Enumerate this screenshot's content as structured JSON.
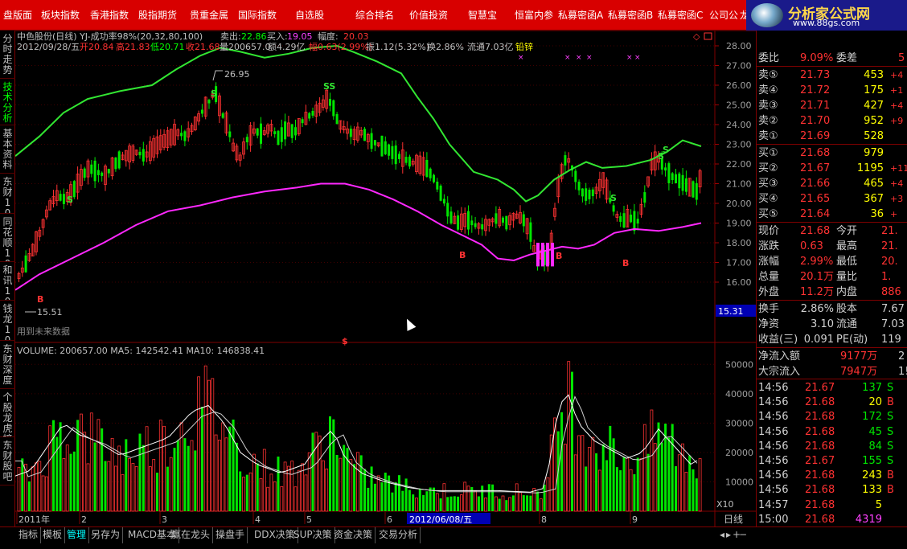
{
  "menu": [
    "盘版面",
    "板块指数",
    "香港指数",
    "股指期货",
    "贵重金属",
    "国际指数",
    "自选股",
    "综合排名",
    "价值投资",
    "智慧宝",
    "恒富内参",
    "私募密函A",
    "私募密函B",
    "私募密函C",
    "公司公告",
    "龙"
  ],
  "brand": {
    "name": "分析家公式网",
    "url": "www.88gs.com"
  },
  "left_tabs": [
    {
      "label": "分时走势",
      "active": false
    },
    {
      "label": "技术分析",
      "active": true
    },
    {
      "label": "基本资料",
      "active": false
    },
    {
      "label": "东财10",
      "active": false
    },
    {
      "label": "同花顺10",
      "active": false
    },
    {
      "label": "和讯10",
      "active": false
    },
    {
      "label": "钱龙10",
      "active": false
    },
    {
      "label": "东财深度",
      "active": false
    },
    {
      "label": "个股龙虎榜",
      "active": false
    },
    {
      "label": "东财股吧",
      "active": false
    }
  ],
  "header": {
    "title": "中色股份(日线) YJ-成功率98%(20,32,80,100)",
    "sell_label": "卖出:",
    "sell_value": "22.86",
    "buy_label": "买入:",
    "buy_value": "19.05",
    "amp_label": "幅度:",
    "amp_value": "20.03",
    "line2": [
      "2012/09/28/五",
      "开20.84",
      "高21.83",
      "低20.71",
      "收21.68",
      "量200657.0",
      "额4.29亿",
      "幅0.63(2.99%)",
      "振1.12(5.32%)",
      "换2.86%",
      "流通7.03亿",
      "铅锌"
    ]
  },
  "chart": {
    "price_axis": [
      "28.00",
      "27.00",
      "26.00",
      "25.00",
      "24.00",
      "23.00",
      "22.00",
      "21.00",
      "20.00",
      "19.00",
      "18.00",
      "17.00",
      "16.00"
    ],
    "current_price_tag": "15.31",
    "high_annotation": "26.95",
    "low_annotation": "15.51",
    "future_note": "用到未来数据",
    "signals": [
      "S",
      "SS",
      "S",
      "S",
      "S",
      "S",
      "B",
      "B",
      "B",
      "B",
      "$"
    ],
    "x_labels": [
      "2011年",
      "2",
      "3",
      "4",
      "5",
      "6",
      "2012/06/08/五",
      "8",
      "9"
    ],
    "period": "日线",
    "zoom": "X10"
  },
  "volume": {
    "header": "VOLUME: 200657.00  MA5: 142542.41  MA10: 146838.41",
    "axis": [
      "50000",
      "40000",
      "30000",
      "20000",
      "10000"
    ]
  },
  "panel": {
    "weibi": {
      "label": "委比",
      "value": "9.09%",
      "label2": "委差",
      "value2": "5"
    },
    "asks": [
      {
        "label": "卖⑤",
        "price": "21.73",
        "vol": "453",
        "chg": "+4"
      },
      {
        "label": "卖④",
        "price": "21.72",
        "vol": "175",
        "chg": "+1"
      },
      {
        "label": "卖③",
        "price": "21.71",
        "vol": "427",
        "chg": "+4"
      },
      {
        "label": "卖②",
        "price": "21.70",
        "vol": "952",
        "chg": "+9"
      },
      {
        "label": "卖①",
        "price": "21.69",
        "vol": "528",
        "chg": ""
      }
    ],
    "bids": [
      {
        "label": "买①",
        "price": "21.68",
        "vol": "979",
        "chg": ""
      },
      {
        "label": "买②",
        "price": "21.67",
        "vol": "1195",
        "chg": "+11"
      },
      {
        "label": "买③",
        "price": "21.66",
        "vol": "465",
        "chg": "+4"
      },
      {
        "label": "买④",
        "price": "21.65",
        "vol": "367",
        "chg": "+3"
      },
      {
        "label": "买⑤",
        "price": "21.64",
        "vol": "36",
        "chg": "+"
      }
    ],
    "quote": [
      {
        "l1": "现价",
        "v1": "21.68",
        "l2": "今开",
        "v2": "21."
      },
      {
        "l1": "涨跌",
        "v1": "0.63",
        "l2": "最高",
        "v2": "21."
      },
      {
        "l1": "涨幅",
        "v1": "2.99%",
        "l2": "最低",
        "v2": "20."
      },
      {
        "l1": "总量",
        "v1": "20.1万",
        "l2": "量比",
        "v2": "1."
      },
      {
        "l1": "外盘",
        "v1": "11.2万",
        "l2": "内盘",
        "v2": "886"
      }
    ],
    "fund": [
      {
        "l1": "换手",
        "v1": "2.86%",
        "l2": "股本",
        "v2": "7.67"
      },
      {
        "l1": "净资",
        "v1": "3.10",
        "l2": "流通",
        "v2": "7.03"
      },
      {
        "l1": "收益(三)",
        "v1": "0.091",
        "l2": "PE(动)",
        "v2": "119"
      }
    ],
    "flow": [
      {
        "label": "净流入额",
        "value": "9177万",
        "extra": "2"
      },
      {
        "label": "大宗流入",
        "value": "7947万",
        "extra": "1!"
      }
    ],
    "ticks": [
      {
        "time": "14:56",
        "price": "21.67",
        "vol": "137",
        "side": "S"
      },
      {
        "time": "14:56",
        "price": "21.68",
        "vol": "20",
        "side": "B"
      },
      {
        "time": "14:56",
        "price": "21.68",
        "vol": "172",
        "side": "S"
      },
      {
        "time": "14:56",
        "price": "21.68",
        "vol": "45",
        "side": "S"
      },
      {
        "time": "14:56",
        "price": "21.68",
        "vol": "84",
        "side": "S"
      },
      {
        "time": "14:56",
        "price": "21.67",
        "vol": "155",
        "side": "S"
      },
      {
        "time": "14:56",
        "price": "21.68",
        "vol": "243",
        "side": "B"
      },
      {
        "time": "14:56",
        "price": "21.68",
        "vol": "133",
        "side": "B"
      },
      {
        "time": "14:57",
        "price": "21.68",
        "vol": "5",
        "side": ""
      },
      {
        "time": "15:00",
        "price": "21.68",
        "vol": "4319",
        "side": ""
      }
    ]
  },
  "bottom_tabs": [
    {
      "label": "指标",
      "active": false
    },
    {
      "label": "模板",
      "active": false
    },
    {
      "label": "管理",
      "active": true
    },
    {
      "label": "另存为",
      "active": false
    },
    {
      "label": "MACD基本",
      "active": false
    },
    {
      "label": "赢在龙头",
      "active": false
    },
    {
      "label": "操盘手",
      "active": false
    },
    {
      "label": "DDX决策",
      "active": false
    },
    {
      "label": "SUP决策",
      "active": false
    },
    {
      "label": "资金决策",
      "active": false
    },
    {
      "label": "交易分析",
      "active": false
    }
  ],
  "colors": {
    "up": "#ff3232",
    "down": "#00e600",
    "upper_band": "#32e632",
    "lower_band": "#ff28ff",
    "grid": "#800000"
  }
}
